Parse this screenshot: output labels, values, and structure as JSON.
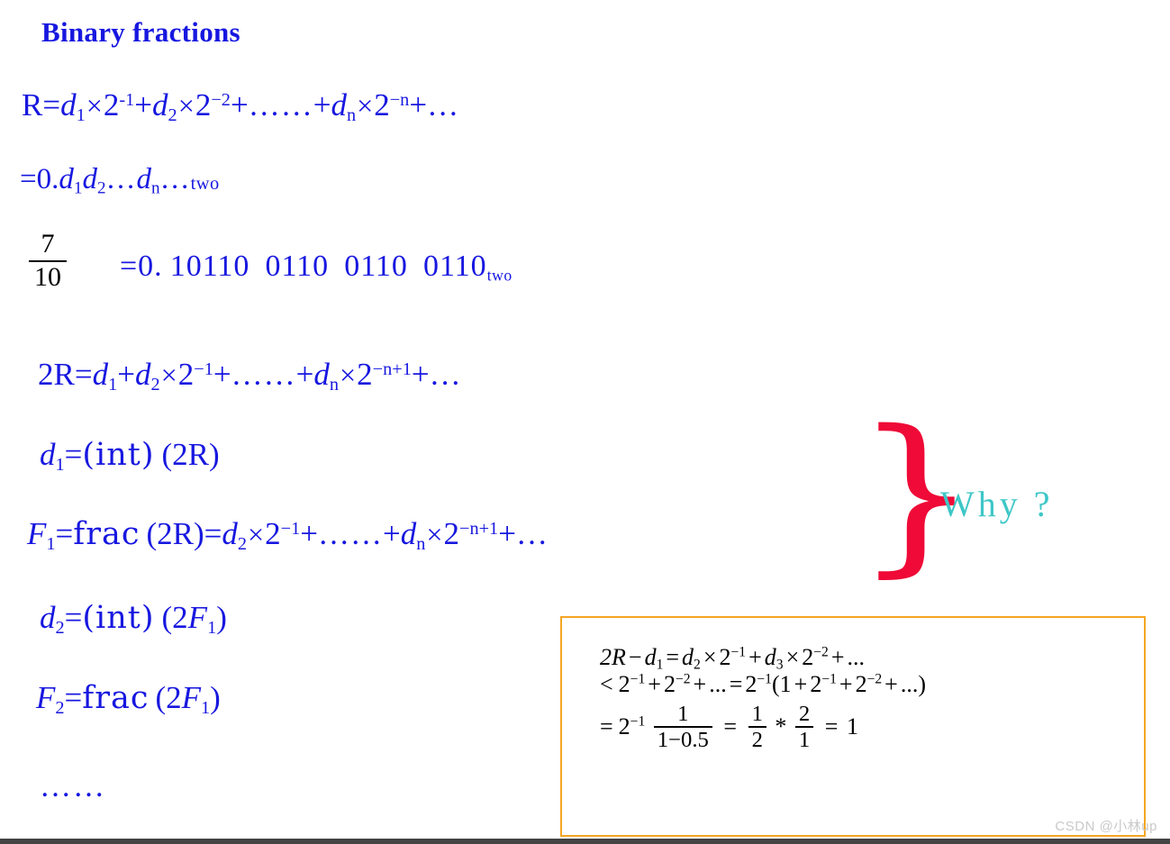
{
  "slide": {
    "title": "Binary fractions",
    "colors": {
      "text_blue": "#1717e0",
      "black": "#000000",
      "brace_red": "#ef0a37",
      "why_teal": "#3ec7c7",
      "box_orange": "#f5a623",
      "bottom_rule": "#444444",
      "watermark": "#c9c9c9"
    }
  },
  "equations": {
    "line1": {
      "lhs": "R=",
      "t1_d": "d",
      "t1_sub": "1",
      "t1_times": "×",
      "t1_base": "2",
      "t1_exp": "-1",
      "plus1": "+",
      "t2_d": "d",
      "t2_sub": "2",
      "t2_times": "×",
      "t2_base": "2",
      "t2_exp": "−2",
      "plus2": "+",
      "ellipsis1": "……",
      "plus3": "+",
      "t3_d": "d",
      "t3_sub": "n",
      "t3_times": "×",
      "t3_base": "2",
      "t3_exp": "−n",
      "plus4": "+",
      "tail": "…"
    },
    "line2": {
      "lead": "=0.",
      "d1": "d",
      "d1_sub": "1",
      "d2": "d",
      "d2_sub": "2",
      "mid_dots": "…",
      "dn": "d",
      "dn_sub": "n",
      "tail_dots": "…",
      "base": "two"
    },
    "fraction": {
      "numerator": "7",
      "denominator": "10"
    },
    "binary_expansion": {
      "lead": "=0.",
      "groups": [
        "10110",
        "0110",
        "0110",
        "0110"
      ],
      "base": "two"
    },
    "line3": {
      "lhs": "2R=",
      "d1": "d",
      "d1_sub": "1",
      "plus1": "+",
      "d2": "d",
      "d2_sub": "2",
      "times1": "×",
      "base1": "2",
      "exp1": "−1",
      "plus2": "+",
      "ellipsis": "……",
      "plus3": "+",
      "dn": "d",
      "dn_sub": "n",
      "times2": "×",
      "base2": "2",
      "exp2": "−n+1",
      "plus4": "+",
      "tail": "…"
    },
    "line4": {
      "lhs_d": "d",
      "lhs_sub": "1",
      "eq": "=",
      "fn": "(int)",
      "arg": "(2R)"
    },
    "line5": {
      "lhs_F": "F",
      "lhs_sub": "1",
      "eq1": "=",
      "fn": "frac",
      "arg": "(2R)",
      "eq2": "=",
      "d2": "d",
      "d2_sub": "2",
      "times1": "×",
      "base1": "2",
      "exp1": "−1",
      "plus1": "+",
      "ellipsis": "……",
      "plus2": "+",
      "dn": "d",
      "dn_sub": "n",
      "times2": "×",
      "base2": "2",
      "exp2": "−n+1",
      "plus3": "+",
      "tail": "…"
    },
    "line6": {
      "lhs_d": "d",
      "lhs_sub": "2",
      "eq": "=",
      "fn": "(int)",
      "arg_open": "(2",
      "arg_F": "F",
      "arg_sub": "1",
      "arg_close": ")"
    },
    "line7": {
      "lhs_F": "F",
      "lhs_sub": "2",
      "eq": "=",
      "fn": "frac",
      "arg_open": "(2",
      "arg_F": "F",
      "arg_sub": "1",
      "arg_close": ")"
    },
    "line8": {
      "dots": "……"
    }
  },
  "annotation": {
    "brace": "}",
    "why_label": "Why ?"
  },
  "proof_box": {
    "row1": {
      "lhs_2R": "2R",
      "minus": "−",
      "d1": "d",
      "d1_sub": "1",
      "eq": "=",
      "d2": "d",
      "d2_sub": "2",
      "times1": "×",
      "base1": "2",
      "exp1": "−1",
      "plus1": "+",
      "d3": "d",
      "d3_sub": "3",
      "times2": "×",
      "base2": "2",
      "exp2": "−2",
      "plus2": "+",
      "tail": "..."
    },
    "row2": {
      "lt": "<",
      "b1": "2",
      "e1": "−1",
      "plus1": "+",
      "b2": "2",
      "e2": "−2",
      "plus2": "+",
      "dots1": "...",
      "eq": "=",
      "b3": "2",
      "e3": "−1",
      "open": "(1",
      "plus3": "+",
      "b4": "2",
      "e4": "−1",
      "plus4": "+",
      "b5": "2",
      "e5": "−2",
      "plus5": "+",
      "dots2": "...",
      "close": ")"
    },
    "row3": {
      "eq1": "=",
      "b1": "2",
      "e1": "−1",
      "frac1_num": "1",
      "frac1_den": "1−0.5",
      "eq2": "=",
      "frac2_num": "1",
      "frac2_den": "2",
      "star": "*",
      "frac3_num": "2",
      "frac3_den": "1",
      "eq3": "=",
      "result": "1"
    }
  },
  "watermark": {
    "text": "CSDN @小林up"
  }
}
